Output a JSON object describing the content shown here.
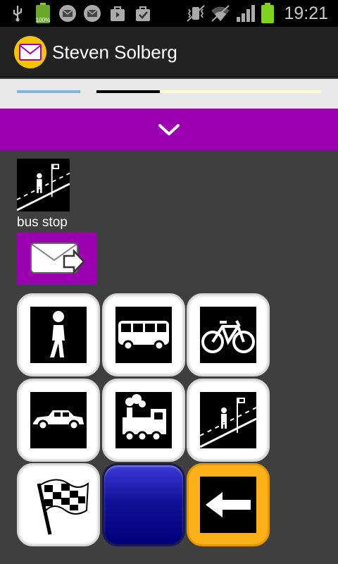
{
  "status_bar": {
    "time": "19:21",
    "battery_left_label": "100%",
    "icons": [
      "usb-icon",
      "battery-icon",
      "mail-icon",
      "mail-icon",
      "bag-icon",
      "bag-check-icon",
      "vibrate-icon",
      "wifi-icon",
      "signal-icon",
      "battery-icon"
    ]
  },
  "app_bar": {
    "title": "Steven Solberg",
    "logo_icon": "mail-icon"
  },
  "expand_bar": {
    "icon": "chevron-down-icon",
    "color": "#9b00b0"
  },
  "selected_symbol": {
    "label": "bus stop",
    "icon": "bus-stop-icon"
  },
  "send_button": {
    "icon": "send-mail-icon",
    "color": "#9b00b0"
  },
  "grid": [
    {
      "icon": "walking-person-icon"
    },
    {
      "icon": "bus-icon"
    },
    {
      "icon": "bicycle-icon"
    },
    {
      "icon": "car-icon"
    },
    {
      "icon": "train-icon"
    },
    {
      "icon": "bus-stop-icon"
    },
    {
      "icon": "checkered-flag-icon"
    },
    {
      "icon": "blank-blue-button-icon"
    },
    {
      "icon": "back-arrow-icon"
    }
  ],
  "colors": {
    "accent": "#9b00b0",
    "tile_orange": "#fbb117",
    "tile_blue": "#00007a"
  }
}
